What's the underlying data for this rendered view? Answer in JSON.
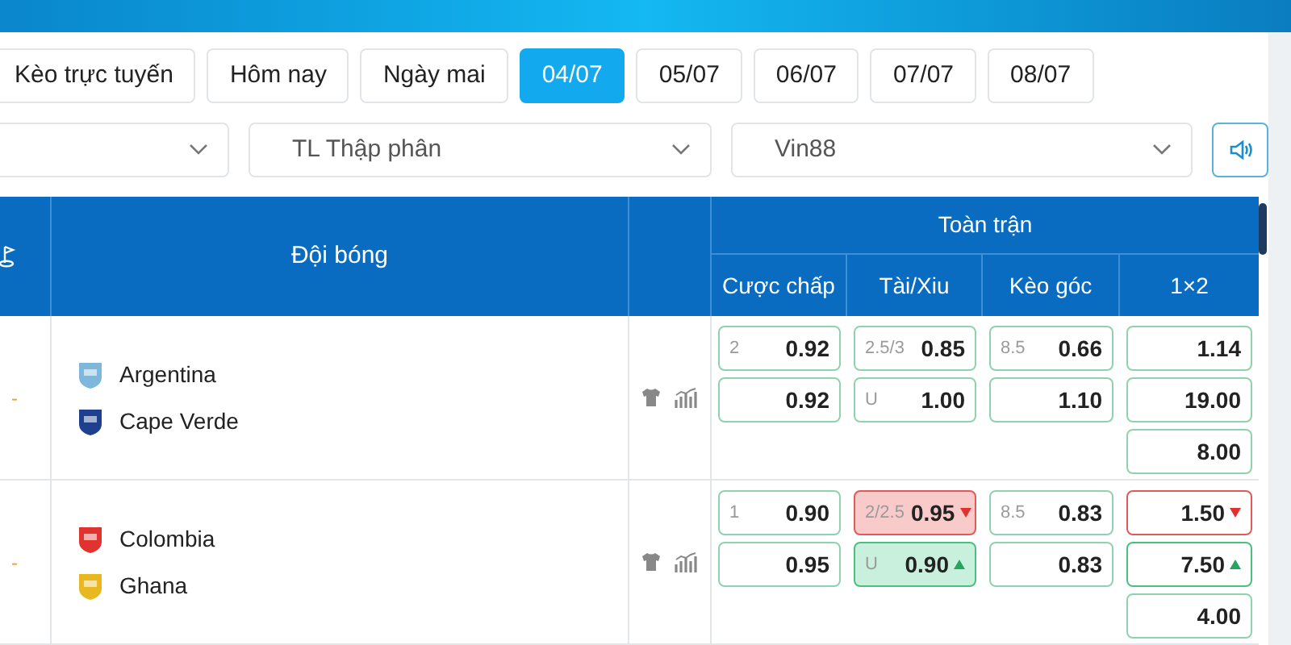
{
  "date_tabs": [
    {
      "label": "Kèo trực tuyến",
      "selected": false
    },
    {
      "label": "Hôm nay",
      "selected": false
    },
    {
      "label": "Ngày mai",
      "selected": false
    },
    {
      "label": "04/07",
      "selected": true
    },
    {
      "label": "05/07",
      "selected": false
    },
    {
      "label": "06/07",
      "selected": false
    },
    {
      "label": "07/07",
      "selected": false
    },
    {
      "label": "08/07",
      "selected": false
    }
  ],
  "filters": [
    {
      "kind": "league"
    },
    {
      "kind": "odds_format",
      "value": "TL Thập phân"
    },
    {
      "kind": "bookmaker",
      "value": "Vin88"
    }
  ],
  "table": {
    "team_header": "Đội bóng",
    "group_header": "Toàn trận",
    "columns": [
      "Cược chấp",
      "Tài/Xiu",
      "Kèo góc",
      "1×2"
    ],
    "matches": [
      {
        "status": "-",
        "teams": [
          {
            "name": "Argentina",
            "color": "#7fb6dc"
          },
          {
            "name": "Cape Verde",
            "color": "#1f3f8f"
          }
        ],
        "markets": [
          [
            {
              "line": "2",
              "value": "0.92"
            },
            {
              "value": "0.92"
            }
          ],
          [
            {
              "line": "2.5/3",
              "value": "0.85"
            },
            {
              "line": "U",
              "value": "1.00"
            }
          ],
          [
            {
              "line": "8.5",
              "value": "0.66"
            },
            {
              "value": "1.10"
            }
          ],
          [
            {
              "value": "1.14"
            },
            {
              "value": "19.00"
            },
            {
              "value": "8.00"
            }
          ]
        ]
      },
      {
        "status": "-",
        "teams": [
          {
            "name": "Colombia",
            "color": "#e0322f"
          },
          {
            "name": "Ghana",
            "color": "#e8b820"
          }
        ],
        "markets": [
          [
            {
              "line": "1",
              "value": "0.90"
            },
            {
              "value": "0.95"
            }
          ],
          [
            {
              "line": "2/2.5",
              "value": "0.95",
              "kind": "falling",
              "highlighted": true
            },
            {
              "line": "U",
              "value": "0.90",
              "kind": "rising",
              "highlighted": true
            }
          ],
          [
            {
              "line": "8.5",
              "value": "0.83"
            },
            {
              "value": "0.83"
            }
          ],
          [
            {
              "value": "1.50",
              "kind": "falling",
              "highlighted": false
            },
            {
              "value": "7.50",
              "kind": "rising",
              "highlighted": false
            },
            {
              "value": "4.00"
            }
          ]
        ]
      }
    ]
  }
}
